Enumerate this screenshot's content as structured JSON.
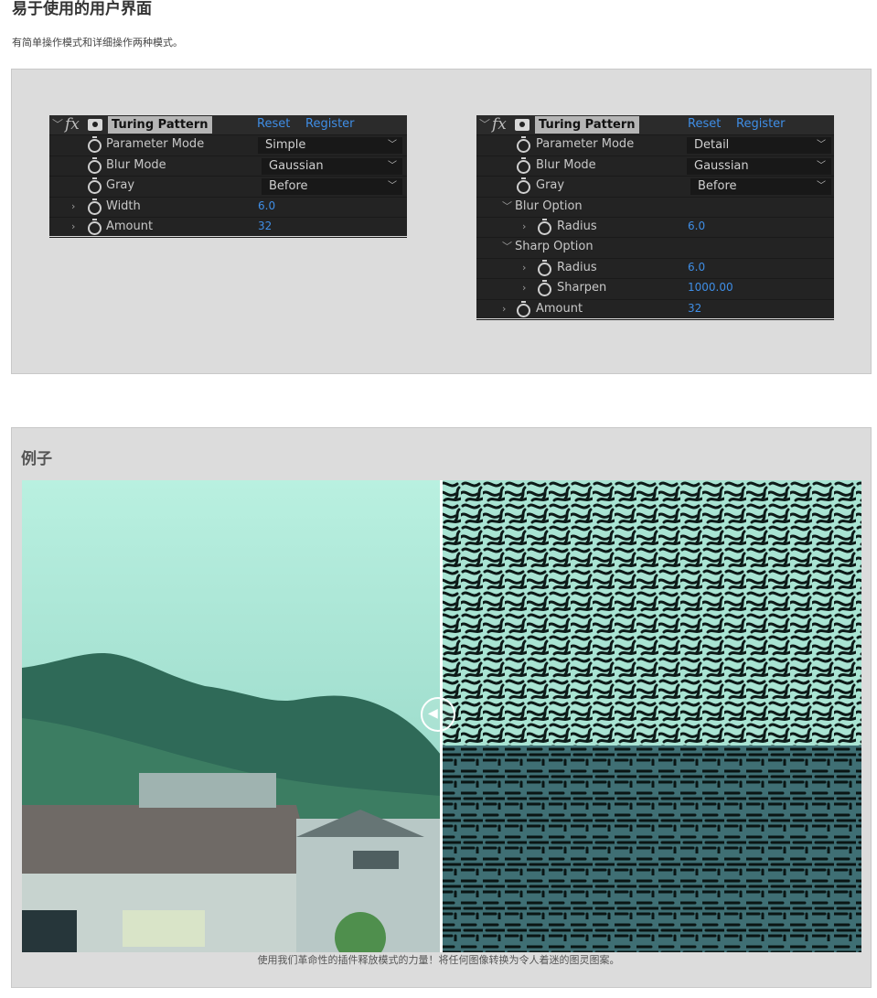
{
  "section": {
    "title": "易于使用的用户界面",
    "subtitle": "有简单操作模式和详细操作两种模式。"
  },
  "panel_simple": {
    "effect_name": "Turing Pattern",
    "reset": "Reset",
    "register": "Register",
    "rows": [
      {
        "label": "Parameter Mode",
        "value": "Simple"
      },
      {
        "label": "Blur Mode",
        "value": "Gaussian"
      },
      {
        "label": "Gray",
        "value": "Before"
      },
      {
        "label": "Width",
        "value": "6.0"
      },
      {
        "label": "Amount",
        "value": "32"
      }
    ]
  },
  "panel_detail": {
    "effect_name": "Turing Pattern",
    "reset": "Reset",
    "register": "Register",
    "rows": [
      {
        "label": "Parameter Mode",
        "value": "Detail"
      },
      {
        "label": "Blur Mode",
        "value": "Gaussian"
      },
      {
        "label": "Gray",
        "value": "Before"
      },
      {
        "label": "Blur Option"
      },
      {
        "label": "Radius",
        "value": "6.0"
      },
      {
        "label": "Sharp Option"
      },
      {
        "label": "Radius",
        "value": "6.0"
      },
      {
        "label": "Sharpen",
        "value": "1000.00"
      },
      {
        "label": "Amount",
        "value": "32"
      }
    ]
  },
  "example": {
    "title": "例子",
    "caption": "使用我们革命性的插件释放模式的力量！将任何图像转换为令人着迷的图灵图案。"
  },
  "colors": {
    "panel_bg": "#232323",
    "link_blue": "#3f8ee6",
    "box_grey": "#dcdcdc"
  }
}
